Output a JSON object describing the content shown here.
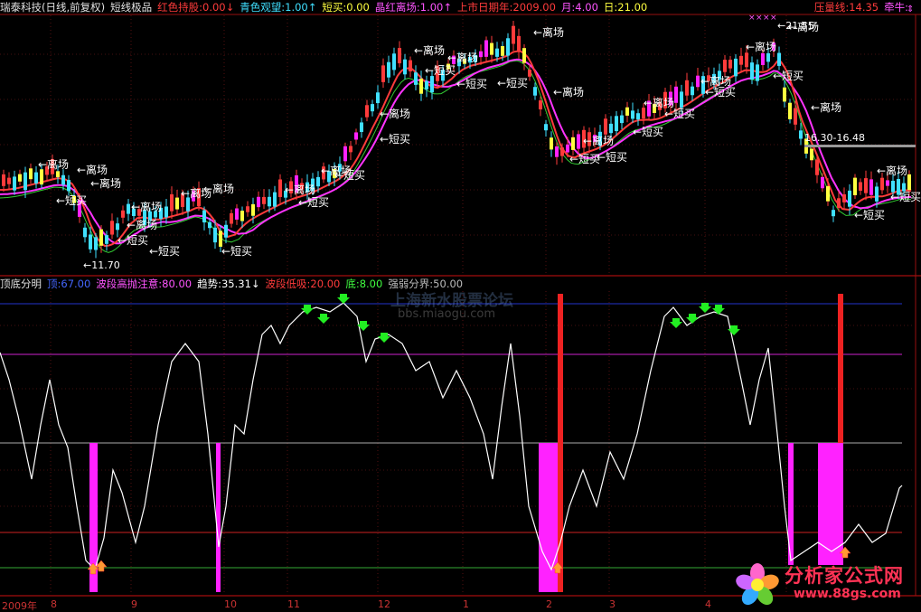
{
  "main_header": {
    "title": "瑞泰科技(日线,前复权)",
    "formula": "短线极品",
    "items": [
      {
        "label": "红色持股:",
        "value": "0.00",
        "arrow": "↓",
        "color": "#ff3b3b"
      },
      {
        "label": "青色观望:",
        "value": "1.00",
        "arrow": "↑",
        "color": "#40e0ff"
      },
      {
        "label": "短买:",
        "value": "0.00",
        "arrow": "",
        "color": "#ffff40"
      },
      {
        "label": "晶红离场:",
        "value": "1.00",
        "arrow": "↑",
        "color": "#ff55ff"
      },
      {
        "label": "上市日期年:",
        "value": "2009.00",
        "arrow": "",
        "color": "#ff3b3b"
      },
      {
        "label": "月:",
        "value": "4.00",
        "arrow": "",
        "color": "#ff55ff"
      },
      {
        "label": "日:",
        "value": "21.00",
        "arrow": "",
        "color": "#ffff40"
      }
    ],
    "right_items": [
      {
        "label": "压量线:",
        "value": "14.35",
        "color": "#ff3b3b"
      },
      {
        "label": "牵牛:",
        "value": "",
        "color": "#ff55ff"
      }
    ]
  },
  "sub_header": {
    "title": "顶底分明",
    "items": [
      {
        "label": "顶:",
        "value": "67.00",
        "color": "#4466ff"
      },
      {
        "label": "波段高抛注意:",
        "value": "80.00",
        "color": "#ff55ff"
      },
      {
        "label": "趋势:",
        "value": "35.31",
        "arrow": "↓",
        "color": "#ffffff"
      },
      {
        "label": "波段低吸:",
        "value": "20.00",
        "color": "#ff3b3b"
      },
      {
        "label": "底:",
        "value": "8.00",
        "color": "#40ff40"
      },
      {
        "label": "强弱分界:",
        "value": "50.00",
        "color": "#bbbbbb"
      }
    ]
  },
  "annotations": {
    "exit": "离场",
    "buy": "短买",
    "low_price": "←11.70",
    "high_price": "←21.55",
    "range": "16.30-16.48"
  },
  "watermark": {
    "line1": "上海新水股票论坛",
    "line2": "bbs.miaogu.com"
  },
  "logo": {
    "line1": "分析家公式网",
    "line2": "www.88gs.com"
  },
  "x_axis": {
    "labels": [
      "2009年",
      "8",
      "9",
      "10",
      "11",
      "12",
      "1",
      "2",
      "3",
      "4"
    ]
  },
  "colors": {
    "up": "#ff3b3b",
    "down": "#40e0ff",
    "ma_fast": "#ff3b3b",
    "ma_slow": "#ff33ff",
    "ma_long": "#33cc33",
    "osc": "#ffffff",
    "line_top": "#2233cc",
    "line_80": "#cc22cc",
    "line_50": "#aaaaaa",
    "line_20": "#cc2222",
    "line_8": "#33aa33",
    "bar_magenta": "#ff22ff",
    "bar_red": "#ee2222"
  }
}
